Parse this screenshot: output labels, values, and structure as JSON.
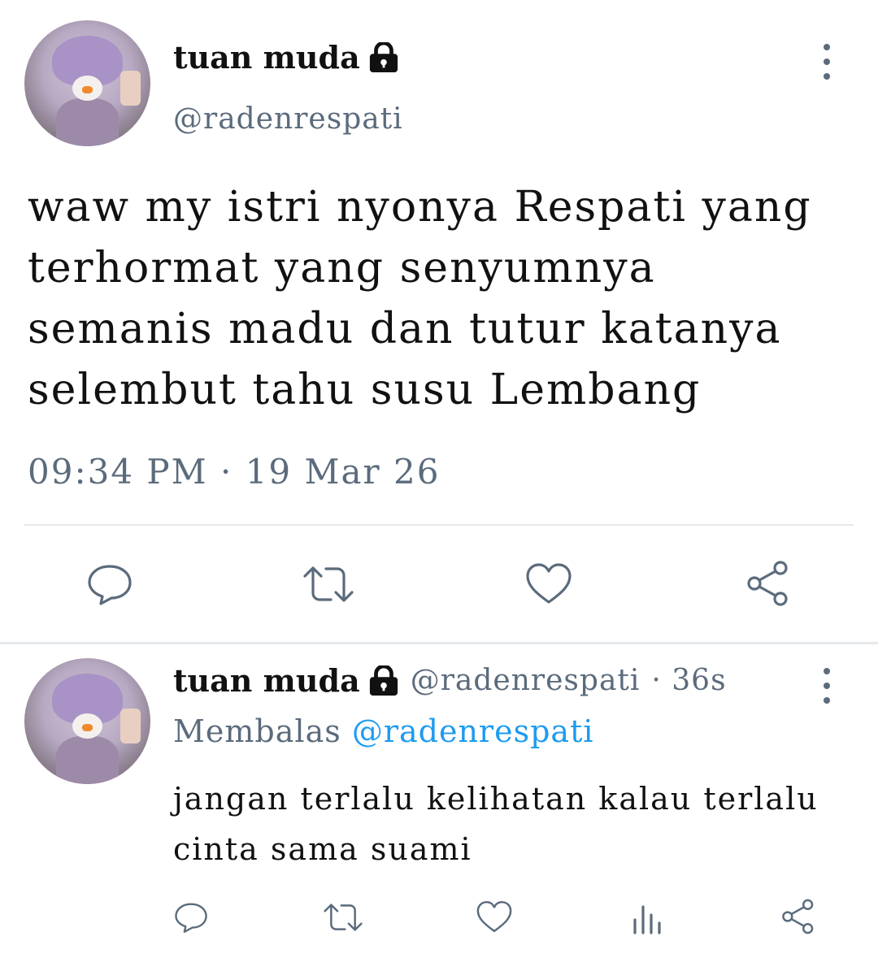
{
  "tweet": {
    "display_name": "tuan muda",
    "handle": "@radenrespati",
    "text": "waw my istri nyonya Respati yang terhormat yang senyumnya semanis madu dan tutur katanya selembut tahu susu Lembang",
    "timestamp": "09:34 PM · 19 Mar 26",
    "actions": [
      "reply-icon",
      "retweet-icon",
      "like-icon",
      "share-icon"
    ]
  },
  "reply": {
    "display_name": "tuan muda",
    "handle": "@radenrespati",
    "age": "· 36s",
    "replying_prefix": "Membalas",
    "replying_to": "@radenrespati",
    "text": "jangan terlalu kelihatan kalau terlalu cinta sama suami",
    "actions": [
      "reply-icon",
      "retweet-icon",
      "like-icon",
      "views-icon",
      "share-icon"
    ]
  },
  "colors": {
    "text": "#111111",
    "secondary": "#5b6b7c",
    "link": "#1d9bf0",
    "divider": "#e6e9ec"
  }
}
